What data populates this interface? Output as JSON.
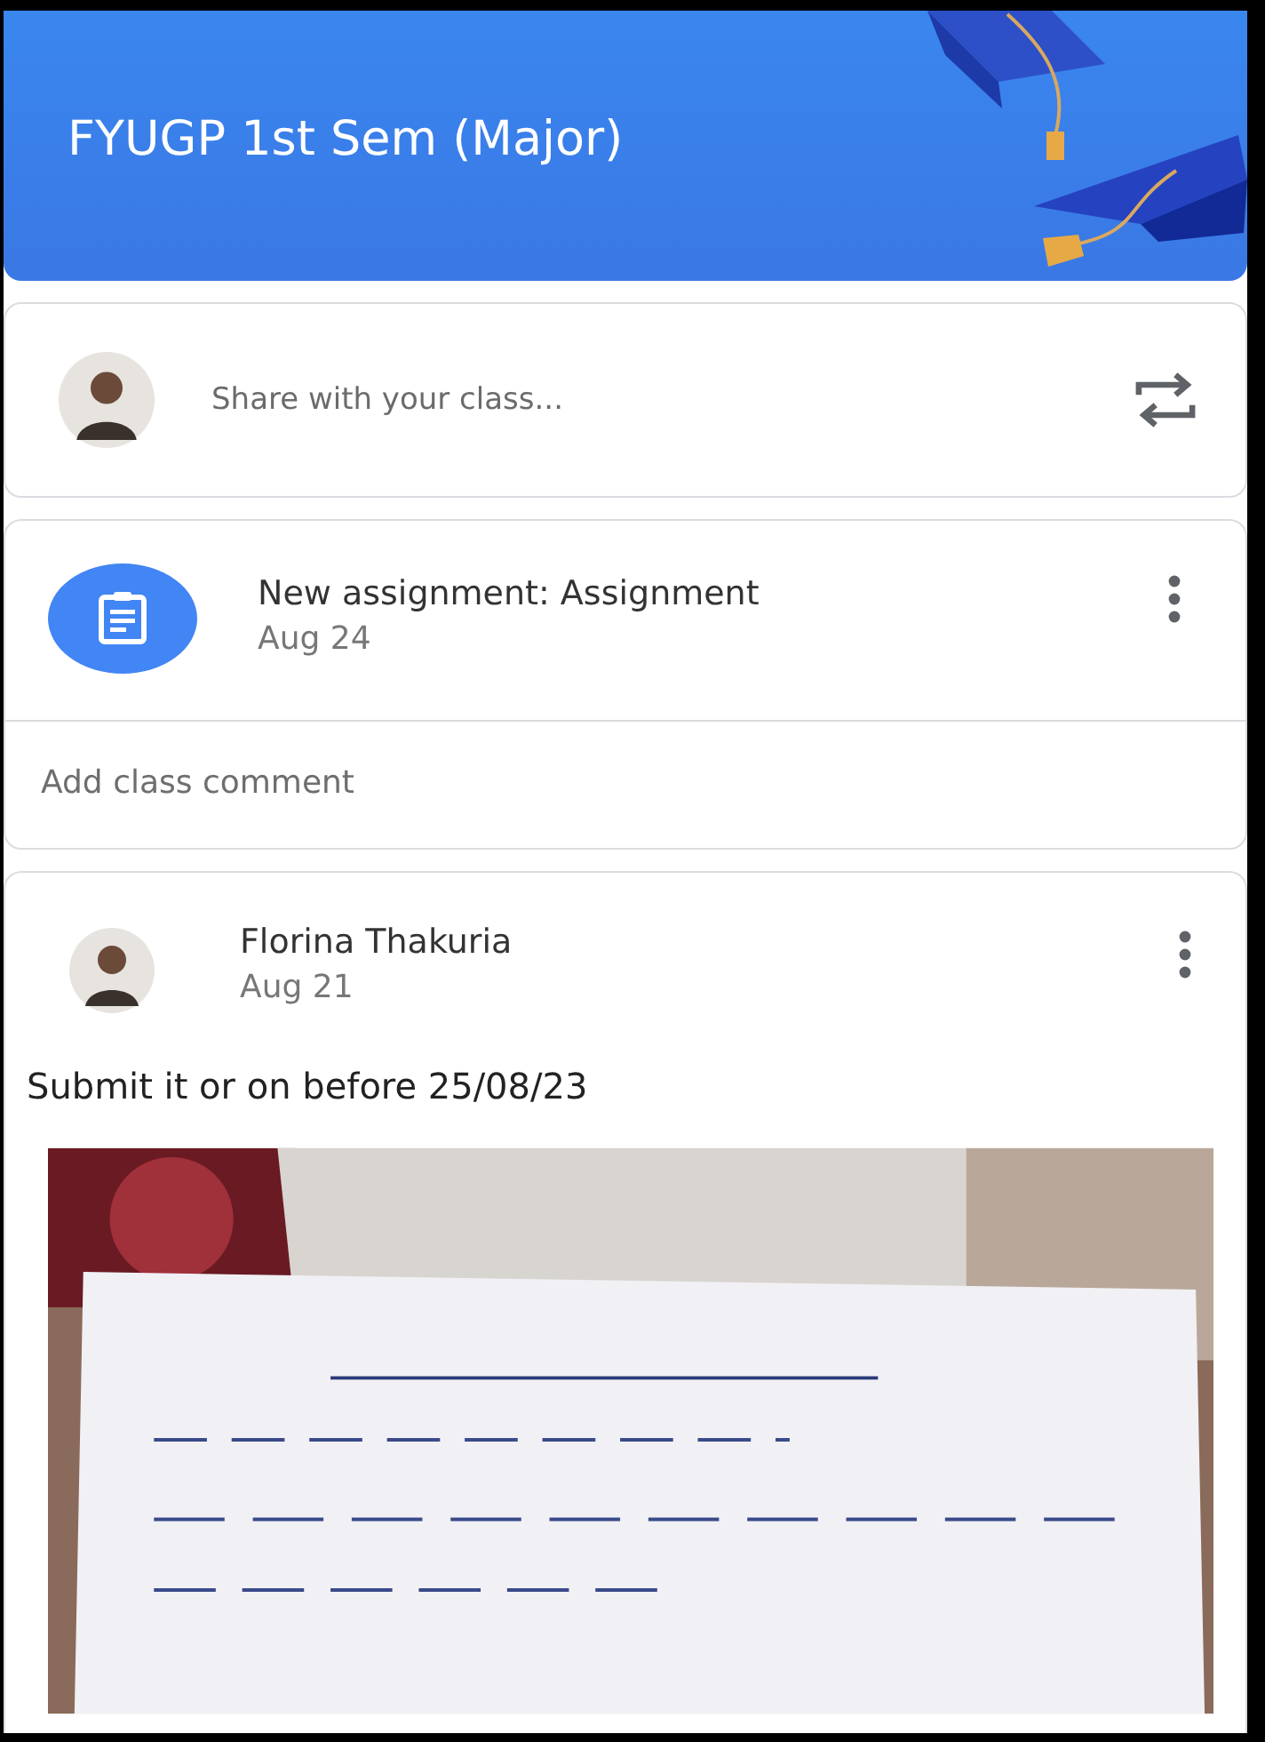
{
  "banner": {
    "title": "FYUGP 1st Sem (Major)"
  },
  "share": {
    "placeholder": "Share with your class..."
  },
  "assignment": {
    "title": "New assignment: Assignment",
    "date": "Aug 24",
    "comment_placeholder": "Add class comment"
  },
  "post": {
    "author": "Florina Thakuria",
    "date": "Aug 21",
    "text": "Submit it or on before 25/08/23"
  }
}
